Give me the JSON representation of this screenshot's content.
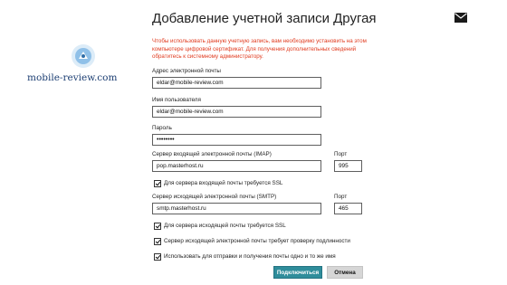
{
  "dialog": {
    "title": "Добавление учетной записи Другая",
    "mail_icon": "envelope-icon",
    "warning": "Чтобы использовать данную учетную запись, вам необходимо установить на этом компьютере цифровой сертификат. Для получения дополнительных сведений обратитесь к системному администратору.",
    "warning_color": "#e03a1e"
  },
  "watermark": {
    "text": "mobile-review.com"
  },
  "form": {
    "email": {
      "label": "Адрес электронной почты",
      "value": "eldar@mobile-review.com"
    },
    "username": {
      "label": "Имя пользователя",
      "value": "eldar@mobile-review.com"
    },
    "password": {
      "label": "Пароль",
      "value": "••••••••"
    },
    "incoming": {
      "label": "Сервер входящей электронной почты (IMAP)",
      "value": "pop.masterhost.ru",
      "port_label": "Порт",
      "port": "995"
    },
    "incoming_ssl": {
      "label": "Для сервера входящей почты требуется SSL",
      "checked": true
    },
    "outgoing": {
      "label": "Сервер исходящей электронной почты (SMTP)",
      "value": "smtp.masterhost.ru",
      "port_label": "Порт",
      "port": "465"
    },
    "outgoing_ssl": {
      "label": "Для сервера исходящей почты требуется SSL",
      "checked": true
    },
    "outgoing_auth": {
      "label": "Сервер исходящей электронной почты требует проверку подлинности",
      "checked": true
    },
    "same_credentials": {
      "label": "Использовать для отправки и получения почты одно и то же имя",
      "checked": true
    }
  },
  "buttons": {
    "connect": "Подключиться",
    "cancel": "Отмена",
    "accent_color": "#2f8d9b"
  }
}
